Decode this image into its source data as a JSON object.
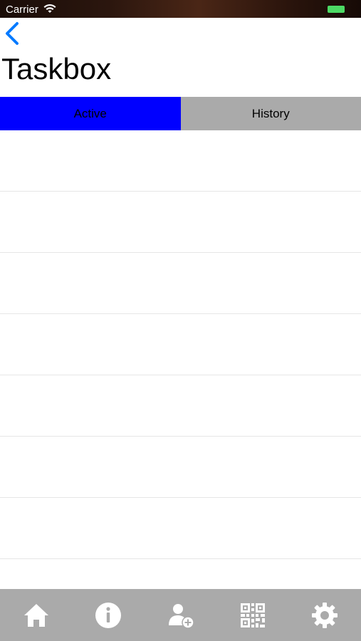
{
  "status_bar": {
    "carrier": "Carrier"
  },
  "nav": {
    "title": "Taskbox"
  },
  "tabs": [
    {
      "label": "Active",
      "selected": true,
      "color": "#0000ff"
    },
    {
      "label": "History",
      "selected": false,
      "color": "#aaaaaa"
    }
  ],
  "task_list": {
    "rows": 8
  },
  "tab_bar": {
    "items": [
      {
        "icon": "home-icon"
      },
      {
        "icon": "info-icon"
      },
      {
        "icon": "add-user-icon"
      },
      {
        "icon": "qr-code-icon"
      },
      {
        "icon": "settings-icon"
      }
    ],
    "background": "#aaaaaa"
  }
}
